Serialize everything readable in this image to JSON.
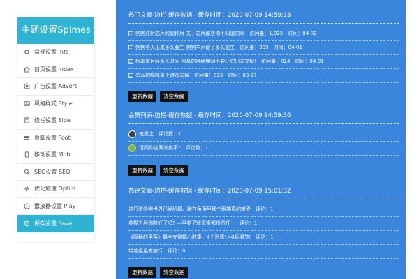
{
  "sidebar": {
    "title": "主题设置Spimes",
    "items": [
      {
        "label": "常规设置 Info",
        "icon": "gear-icon"
      },
      {
        "label": "首页设置 Index",
        "icon": "home-icon"
      },
      {
        "label": "广告设置 Advert",
        "icon": "target-icon"
      },
      {
        "label": "风格样式 Style",
        "icon": "image-icon"
      },
      {
        "label": "边栏设置 Side",
        "icon": "sidebar-icon"
      },
      {
        "label": "页脚设置 Foot",
        "icon": "list-icon"
      },
      {
        "label": "移动设置 Mobi",
        "icon": "mobile-icon"
      },
      {
        "label": "SEO设置 SEO",
        "icon": "search-icon"
      },
      {
        "label": "优化加速 Optim",
        "icon": "bolt-icon"
      },
      {
        "label": "播放器设置 Play",
        "icon": "play-icon"
      },
      {
        "label": "保存设置 Save",
        "icon": "shield-icon"
      }
    ]
  },
  "sections": {
    "hot": {
      "header": "热门文章-边栏-缓存数据 - 缓存时间：2020-07-09 14:59:33",
      "rows": [
        {
          "title": "狗狗注射芯片的副作用 关于芯片那些你不知道的事",
          "views_label": "访问量：",
          "views": "1,025",
          "time_label": "时间：",
          "time": "04-02"
        },
        {
          "title": "狗狗冬天出来多久会生 狗狗羊水破了多久能生",
          "views_label": "访问量：",
          "views": "999",
          "time_label": "时间：",
          "time": "04-01"
        },
        {
          "title": "柯基来月经多长时间 柯基的月经期间不要让它出去交配!",
          "views_label": "访问量：",
          "views": "824",
          "time_label": "时间：",
          "time": "04-01"
        },
        {
          "title": "怎么把猫咪身上跳蚤去掉",
          "views_label": "访问量：",
          "views": "823",
          "time_label": "时间：",
          "time": "03-27"
        }
      ],
      "refresh": "更新数据",
      "clear": "清空数据"
    },
    "members": {
      "header": "会员列表-边栏-缓存数据 - 缓存时间：2020-07-09 14:59:36",
      "rows": [
        {
          "name": "笔墨之",
          "comments_label": "评论数：",
          "comments": "1",
          "avatar_color": "#3a3a3a"
        },
        {
          "name": "请问你这网站卖不?",
          "comments_label": "评论数：",
          "comments": "1",
          "avatar_color": "#6fbf4a"
        }
      ],
      "refresh": "更新数据",
      "clear": "清空数据"
    },
    "hotcomment": {
      "header": "热评文章-边栏-缓存数据 - 缓存时间：2020-07-09 15:01:32",
      "rows": [
        {
          "title": "这只流浪狗世界已经坍塌。蹲在角落里那个眼神真的难受",
          "comments_label": "评论：",
          "comments": "1"
        },
        {
          "title": "养猫之后你酸好了吗? —旦养了就逛街都份责任~",
          "comments_label": "评论：",
          "comments": "1"
        },
        {
          "title": "《隐秘的角落》最全完整精心收集，4个彩蛋! 40新细节!",
          "comments_label": "评论：",
          "comments": "1"
        },
        {
          "title": "带着兔兔去旅行",
          "comments_label": "评论：",
          "comments": "0"
        }
      ],
      "refresh": "更新数据",
      "clear": "清空数据"
    }
  },
  "colors": {
    "accent": "#2fb3d3",
    "panel": "#3b86dd",
    "button": "#111111"
  }
}
